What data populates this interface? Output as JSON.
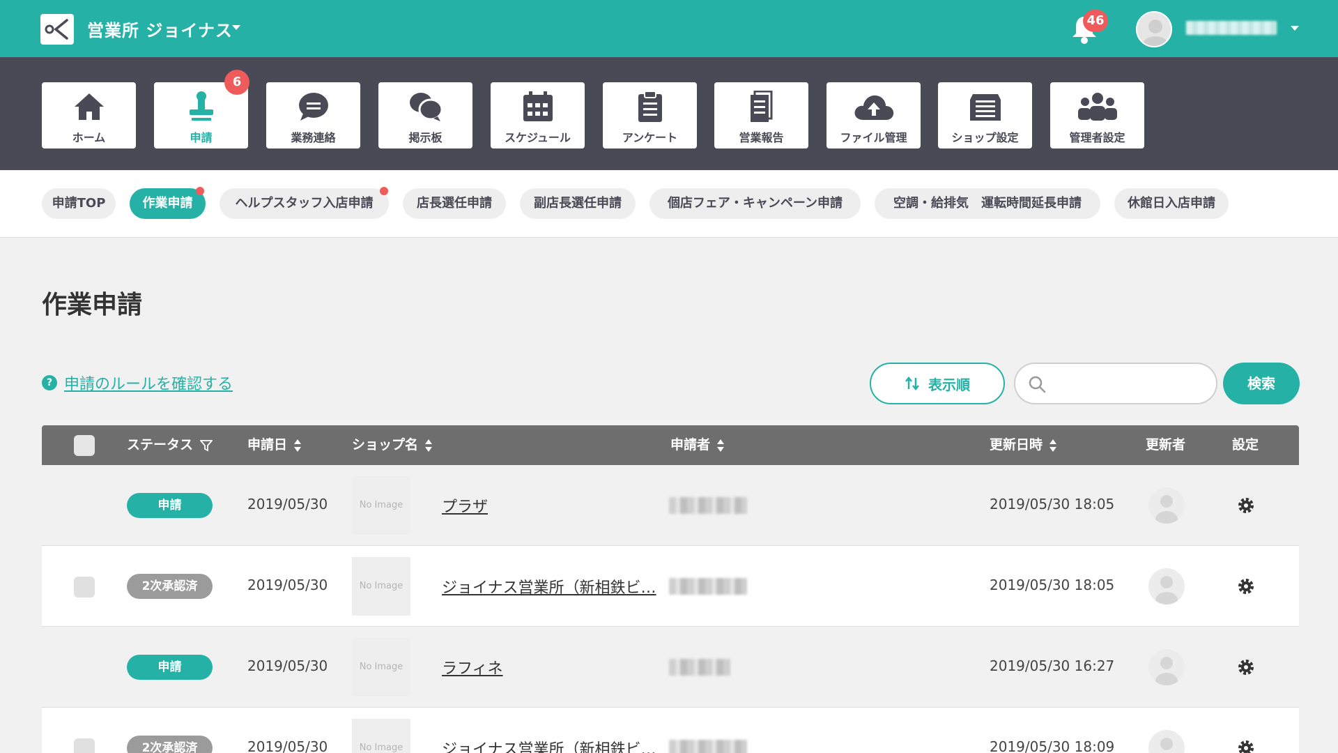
{
  "header": {
    "org_name": "営業所 ジョイナス",
    "notification_count": "46",
    "colors": {
      "primary": "#26b1a6",
      "dark": "#4a4a57",
      "badge": "#ef5a5a"
    }
  },
  "apps": [
    {
      "label": "ホーム",
      "icon": "home-icon"
    },
    {
      "label": "申請",
      "icon": "stamp-icon",
      "badge": "6",
      "active": true
    },
    {
      "label": "業務連絡",
      "icon": "chat-bubble-icon"
    },
    {
      "label": "掲示板",
      "icon": "bulletin-board-icon"
    },
    {
      "label": "スケジュール",
      "icon": "calendar-icon"
    },
    {
      "label": "アンケート",
      "icon": "clipboard-icon"
    },
    {
      "label": "営業報告",
      "icon": "document-icon"
    },
    {
      "label": "ファイル管理",
      "icon": "cloud-upload-icon"
    },
    {
      "label": "ショップ設定",
      "icon": "shop-icon"
    },
    {
      "label": "管理者設定",
      "icon": "users-icon"
    }
  ],
  "subtabs": [
    {
      "label": "申請TOP"
    },
    {
      "label": "作業申請",
      "active": true
    },
    {
      "label": "ヘルプスタッフ入店申請"
    },
    {
      "label": "店長選任申請"
    },
    {
      "label": "副店長選任申請"
    },
    {
      "label": "個店フェア・キャンペーン申請"
    },
    {
      "label": "空調・給排気　運転時間延長申請"
    },
    {
      "label": "休館日入店申請"
    }
  ],
  "page": {
    "title": "作業申請",
    "help_link": "申請のルールを確認する",
    "sort_label": "表示順",
    "search_placeholder": "",
    "search_button": "検索"
  },
  "table": {
    "columns": [
      "ステータス",
      "申請日",
      "ショップ名",
      "申請者",
      "更新日時",
      "更新者",
      "設定"
    ],
    "rows": [
      {
        "status": "申請",
        "status_type": "applied",
        "date": "2019/05/30",
        "thumb": "No Image",
        "shop": "プラザ",
        "updated": "2019/05/30 18:05"
      },
      {
        "status": "2次承認済",
        "status_type": "approved",
        "date": "2019/05/30",
        "thumb": "No Image",
        "shop": "ジョイナス営業所（新相鉄ビ…",
        "updated": "2019/05/30 18:05"
      },
      {
        "status": "申請",
        "status_type": "applied",
        "date": "2019/05/30",
        "thumb": "No Image",
        "shop": "ラフィネ",
        "updated": "2019/05/30 16:27"
      },
      {
        "status": "2次承認済",
        "status_type": "approved",
        "date": "2019/05/30",
        "thumb": "No Image",
        "shop": "ジョイナス営業所（新相鉄ビ…",
        "updated": "2019/05/30 18:09"
      }
    ]
  }
}
